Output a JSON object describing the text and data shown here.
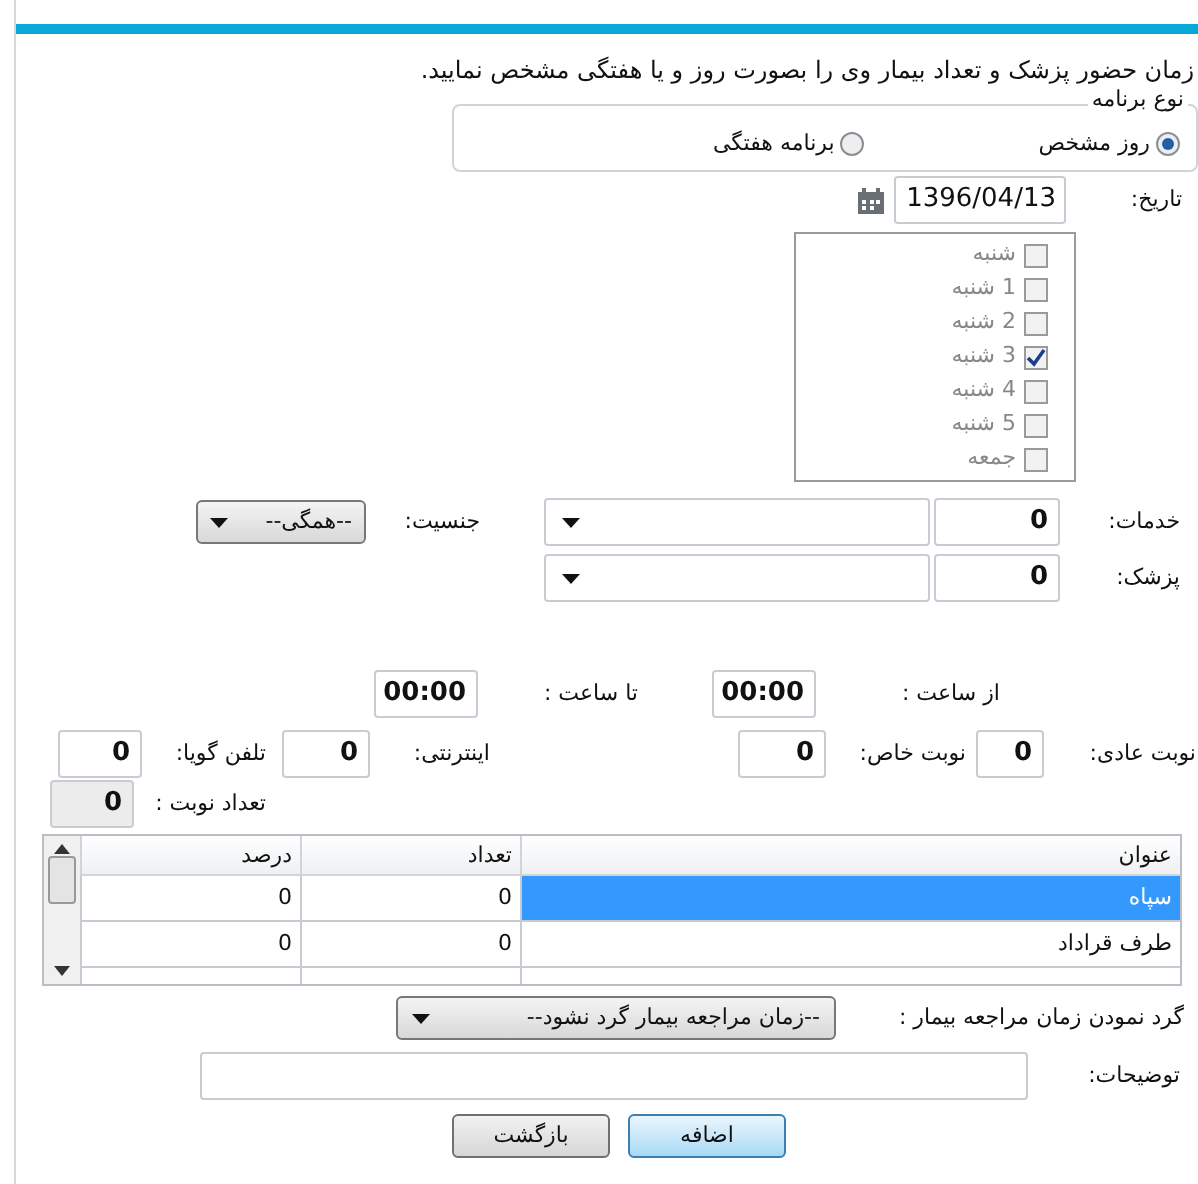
{
  "instruction": "زمان حضور پزشک و تعداد بیمار وی را بصورت روز و یا هفتگی مشخص نمایید.",
  "program_type": {
    "legend": "نوع برنامه",
    "options": [
      {
        "label": "روز مشخص",
        "selected": true
      },
      {
        "label": "برنامه هفتگی",
        "selected": false
      }
    ]
  },
  "date": {
    "label": "تاریخ:",
    "value": "1396/04/13"
  },
  "days": [
    {
      "label": "شنبه",
      "checked": false
    },
    {
      "label": "1 شنبه",
      "checked": false
    },
    {
      "label": "2 شنبه",
      "checked": false
    },
    {
      "label": "3 شنبه",
      "checked": true
    },
    {
      "label": "4 شنبه",
      "checked": false
    },
    {
      "label": "5 شنبه",
      "checked": false
    },
    {
      "label": "جمعه",
      "checked": false
    }
  ],
  "services": {
    "label": "خدمات:",
    "code": "0"
  },
  "gender": {
    "label": "جنسیت:",
    "value": "--همگی--"
  },
  "doctor": {
    "label": "پزشک:",
    "code": "0"
  },
  "from_time": {
    "label": "از ساعت :",
    "value": "00:00"
  },
  "to_time": {
    "label": "تا ساعت :",
    "value": "00:00"
  },
  "quotas": [
    {
      "label": "نوبت عادی:",
      "value": "0"
    },
    {
      "label": "نوبت خاص:",
      "value": "0"
    },
    {
      "label": "اینترنتی:",
      "value": "0"
    },
    {
      "label": "تلفن گویا:",
      "value": "0"
    }
  ],
  "total": {
    "label": "تعداد نوبت :",
    "value": "0",
    "disabled": true
  },
  "table": {
    "columns": [
      "عنوان",
      "تعداد",
      "درصد"
    ],
    "rows": [
      {
        "cells": [
          "سپاه",
          "0",
          "0"
        ],
        "selected": true
      },
      {
        "cells": [
          "طرف قراداد",
          "0",
          "0"
        ],
        "selected": false
      }
    ]
  },
  "rounding": {
    "label": "گرد نمودن زمان مراجعه بیمار :",
    "value": "--زمان مراجعه بیمار گرد نشود--"
  },
  "notes": {
    "label": "توضیحات:"
  },
  "buttons": [
    {
      "label": "اضافه",
      "focused": true
    },
    {
      "label": "بازگشت",
      "focused": false
    }
  ]
}
